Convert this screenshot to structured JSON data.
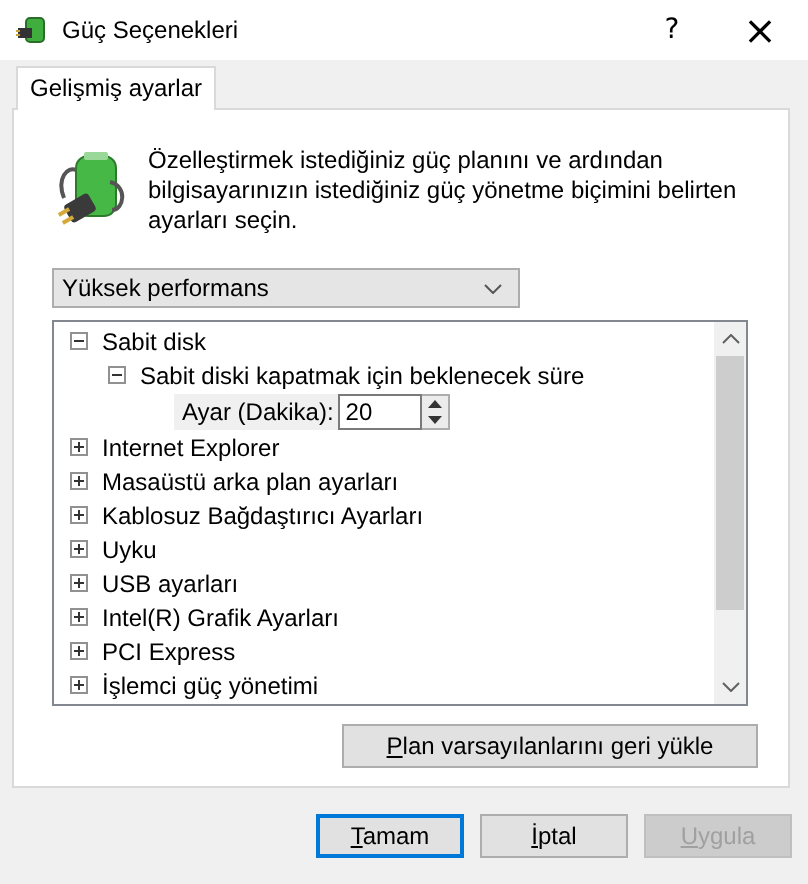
{
  "window": {
    "title": "Güç Seçenekleri",
    "help": "?",
    "close": "×"
  },
  "tabs": [
    {
      "label": "Gelişmiş ayarlar",
      "selected": true
    }
  ],
  "description": "Özelleştirmek istediğiniz güç planını ve ardından bilgisayarınızın istediğiniz güç yönetme biçimini belirten ayarları seçin.",
  "plan_select": {
    "value": "Yüksek performans"
  },
  "settings_tree": [
    {
      "label": "Sabit disk",
      "expanded": true,
      "children": [
        {
          "label": "Sabit diski kapatmak için beklenecek süre",
          "expanded": true,
          "setting": {
            "label": "Ayar (Dakika):",
            "value": "20"
          }
        }
      ]
    },
    {
      "label": "Internet Explorer",
      "expanded": false
    },
    {
      "label": "Masaüstü arka plan ayarları",
      "expanded": false
    },
    {
      "label": "Kablosuz Bağdaştırıcı Ayarları",
      "expanded": false
    },
    {
      "label": "Uyku",
      "expanded": false
    },
    {
      "label": "USB ayarları",
      "expanded": false
    },
    {
      "label": "Intel(R) Grafik Ayarları",
      "expanded": false
    },
    {
      "label": "PCI Express",
      "expanded": false
    },
    {
      "label": "İşlemci güç yönetimi",
      "expanded": false
    }
  ],
  "restore_button": "Plan varsayılanlarını geri yükle",
  "buttons": [
    {
      "label": "Tamam",
      "kind": "default",
      "disabled": false
    },
    {
      "label": "İptal",
      "kind": "normal",
      "disabled": false
    },
    {
      "label": "Uygula",
      "kind": "normal",
      "disabled": true
    }
  ]
}
